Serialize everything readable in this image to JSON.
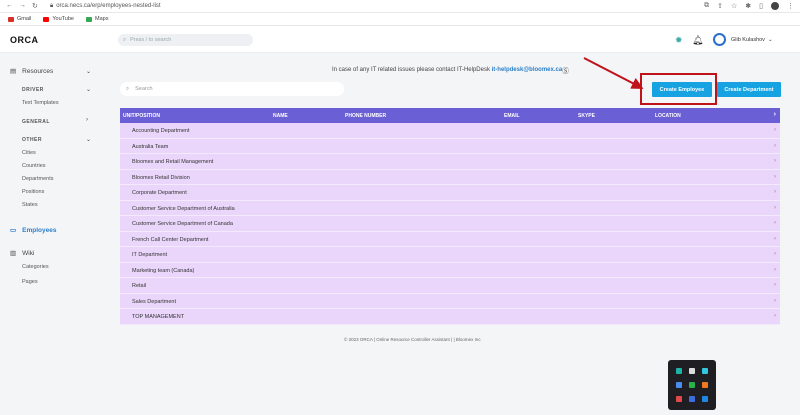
{
  "browser": {
    "url": "orca.necs.ca/erp/employees-nested-list",
    "bookmarks": [
      {
        "label": "Gmail",
        "color": "#d93025"
      },
      {
        "label": "YouTube",
        "color": "#ff0000"
      },
      {
        "label": "Maps",
        "color": "#34a853"
      }
    ]
  },
  "header": {
    "logo": "ORCA",
    "search_placeholder": "Press / to search",
    "user_name": "Glib Kulashov"
  },
  "sidebar": {
    "resources_label": "Resources",
    "driver_label": "DRIVER",
    "text_templates": "Text Templates",
    "general_label": "GENERAL",
    "other_label": "OTHER",
    "other_items": [
      "Cities",
      "Countries",
      "Departments",
      "Positions",
      "States"
    ],
    "employees_label": "Employees",
    "wiki_label": "Wiki",
    "wiki_items": [
      "Categories",
      "Pages"
    ]
  },
  "main": {
    "notice_prefix": "In case of any IT related issues please contact IT-HelpDesk",
    "notice_email": "it-helpdesk@bloomex.ca",
    "search_placeholder": "Search",
    "create_employee": "Create Employee",
    "create_department": "Create Department",
    "columns": [
      "UNIT/POSITION",
      "NAME",
      "PHONE NUMBER",
      "EMAIL",
      "SKYPE",
      "LOCATION"
    ],
    "rows": [
      "Accounting Department",
      "Australia Team",
      "Bloomex and Retail Management",
      "Bloomex Retail Division",
      "Corporate Department",
      "Customer Service Department of Australia",
      "Customer Service Department of Canada",
      "French Call Center Department",
      "IT Department",
      "Marketing team (Canada)",
      "Retail",
      "Sales Department",
      "TOP MANAGEMENT"
    ],
    "footer": "© 2023 ORCA | Online Resource Controller Assistant | | Bloomex Inc"
  },
  "colors": {
    "accent": "#17a2e2",
    "table_header": "#6b5fd6",
    "row_bg": "#ead6fb",
    "highlight": "#c0121a"
  }
}
